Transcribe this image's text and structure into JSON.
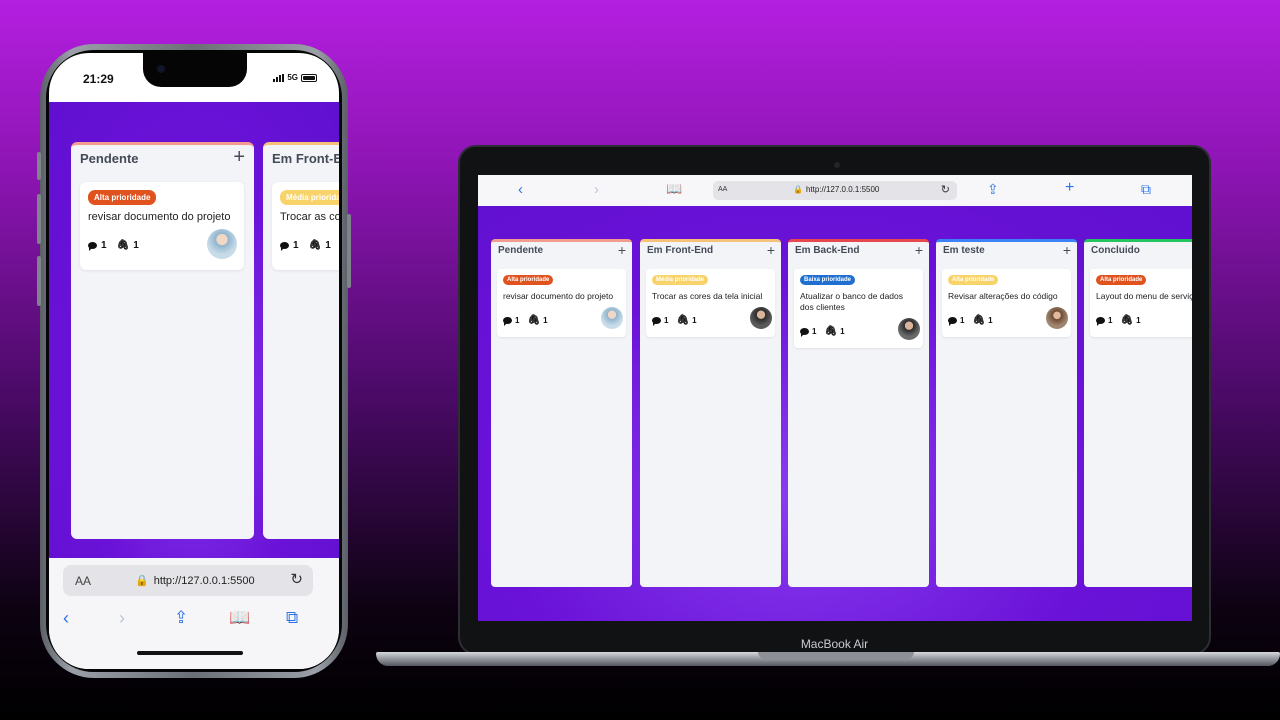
{
  "phone": {
    "status": {
      "time": "21:29",
      "network": "5G"
    },
    "board": {
      "columns": [
        {
          "title": "Pendente",
          "add": "+",
          "card": {
            "badge": "Alta prioridade",
            "text": "revisar documento do projeto",
            "comments": "1",
            "attachments": "1"
          }
        },
        {
          "title": "Em Front-End",
          "add": "+",
          "card": {
            "badge": "Média prioridade",
            "text": "Trocar as cores da tela inicial",
            "comments": "1",
            "attachments": "1"
          }
        }
      ]
    },
    "safari": {
      "aa": "AA",
      "url": "http://127.0.0.1:5500"
    }
  },
  "laptop": {
    "brand": "MacBook Air",
    "safari": {
      "aa": "AA",
      "url": "http://127.0.0.1:5500"
    },
    "board": {
      "columns": [
        {
          "title": "Pendente",
          "add": "+",
          "accent": "#f39b8f",
          "card": {
            "badge": "Alta prioridade",
            "badge_color": "#e0531f",
            "text": "revisar documento do projeto",
            "comments": "1",
            "attachments": "1"
          }
        },
        {
          "title": "Em Front-End",
          "add": "+",
          "accent": "#f6c27a",
          "card": {
            "badge": "Média prioridade",
            "badge_color": "#f8d36a",
            "text": "Trocar as cores da tela inicial",
            "comments": "1",
            "attachments": "1"
          }
        },
        {
          "title": "Em Back-End",
          "add": "+",
          "accent": "#e5484d",
          "card": {
            "badge": "Baixa prioridade",
            "badge_color": "#1f6fd1",
            "text": "Atualizar o banco de dados dos clientes",
            "comments": "1",
            "attachments": "1"
          }
        },
        {
          "title": "Em teste",
          "add": "+",
          "accent": "#3b82f6",
          "card": {
            "badge": "Alta prioridade",
            "badge_color": "#f8d36a",
            "text": "Revisar alterações do código",
            "comments": "1",
            "attachments": "1"
          }
        },
        {
          "title": "Concluido",
          "add": "+",
          "accent": "#22c55e",
          "card": {
            "badge": "Alta prioridade",
            "badge_color": "#e0531f",
            "text": "Layout do menu de serviços",
            "comments": "1",
            "attachments": "1"
          }
        }
      ]
    }
  }
}
